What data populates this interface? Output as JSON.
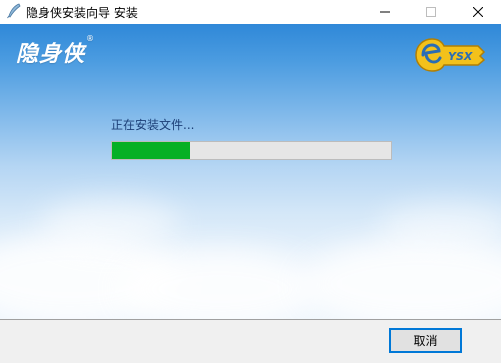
{
  "window": {
    "title": "隐身侠安装向导 安装",
    "minimize_glyph": "—",
    "maximize_glyph": "☐",
    "close_glyph": "✕"
  },
  "header": {
    "logo_text": "隐身侠",
    "logo_mark": "®",
    "brand_logo_text": "YSX"
  },
  "install": {
    "status_text": "正在安装文件...",
    "progress_fraction": 0.28
  },
  "footer": {
    "cancel_label": "取消"
  },
  "colors": {
    "progress_fill": "#06b025",
    "accent": "#0078d7",
    "sky_top": "#2f88d8"
  }
}
